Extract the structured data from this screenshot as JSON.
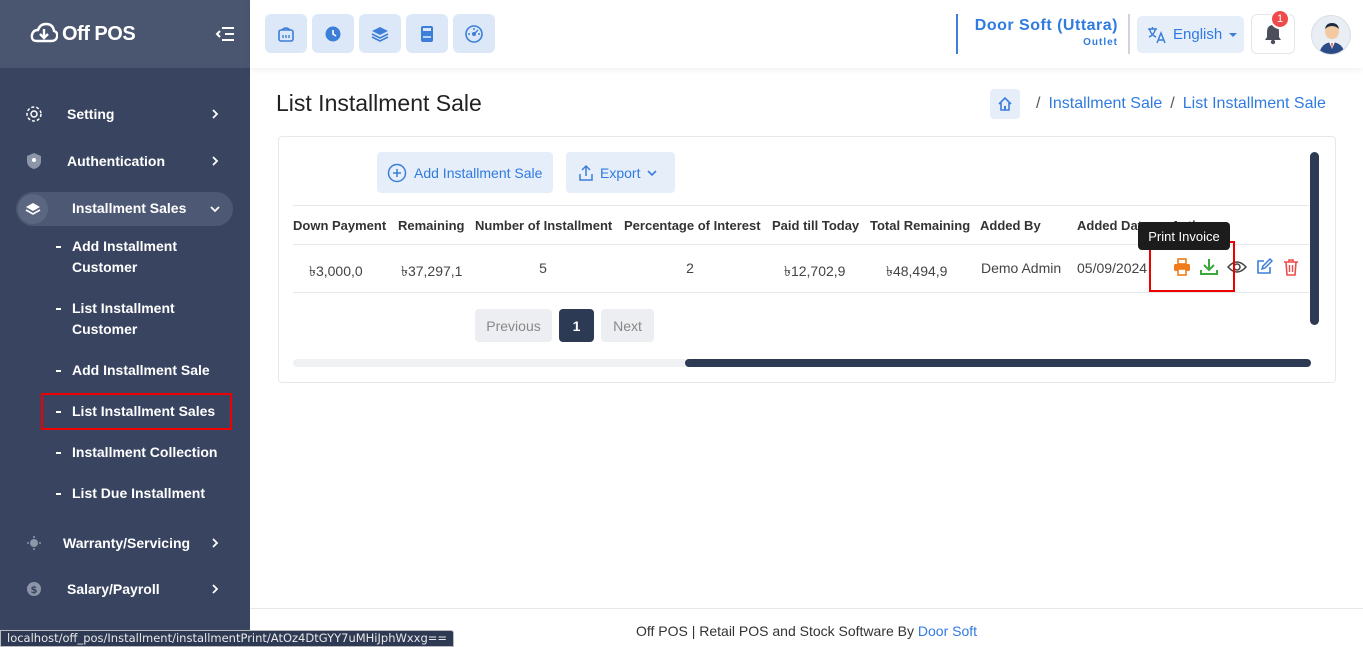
{
  "app": {
    "name": "Off POS"
  },
  "sidebar": {
    "menu": [
      {
        "label": "Setting",
        "icon": "gear-icon"
      },
      {
        "label": "Authentication",
        "icon": "shield-icon"
      },
      {
        "label": "Installment Sales",
        "icon": "layers-icon"
      },
      {
        "label": "Warranty/Servicing",
        "icon": "service-icon"
      },
      {
        "label": "Salary/Payroll",
        "icon": "dollar-icon"
      }
    ],
    "sub_items": [
      {
        "label": "Add Installment Customer"
      },
      {
        "label": "List Installment Customer"
      },
      {
        "label": "Add Installment Sale"
      },
      {
        "label": "List Installment Sales"
      },
      {
        "label": "Installment Collection"
      },
      {
        "label": "List Due Installment"
      }
    ]
  },
  "topbar": {
    "quick_buttons": [
      "pos-icon",
      "clock-icon",
      "layers-icon",
      "calculator-icon",
      "dashboard-icon"
    ],
    "outlet_name": "Door Soft (Uttara)",
    "outlet_sub": "Outlet",
    "language": "English",
    "notification_count": "1"
  },
  "page": {
    "title": "List Installment Sale",
    "breadcrumb": [
      "Installment Sale",
      "List Installment Sale"
    ]
  },
  "toolbar": {
    "add_label": "Add Installment Sale",
    "export_label": "Export"
  },
  "table": {
    "headers": [
      "Down Payment",
      "Remaining",
      "Number of Installment",
      "Percentage of Interest",
      "Paid till Today",
      "Total Remaining",
      "Added By",
      "Added Date",
      "Actions"
    ],
    "rows": [
      {
        "down_payment": "৳3,000,0",
        "remaining": "৳37,297,1",
        "installments": "5",
        "interest": "2",
        "paid": "৳12,702,9",
        "total_remaining": "৳48,494,9",
        "added_by": "Demo Admin",
        "added_date": "05/09/2024"
      }
    ],
    "tooltip": "Print Invoice"
  },
  "pagination": {
    "previous": "Previous",
    "current": "1",
    "next": "Next"
  },
  "footer": {
    "text": "Off POS | Retail POS and Stock Software By ",
    "link": "Door Soft"
  },
  "status_url": "localhost/off_pos/Installment/installmentPrint/AtOz4DtGYY7uMHiJphWxxg==",
  "colors": {
    "sidebar": "#384460",
    "accent": "#2f7be0",
    "print": "#f07c1b",
    "download": "#3aa83a",
    "delete": "#ef4b4b"
  }
}
